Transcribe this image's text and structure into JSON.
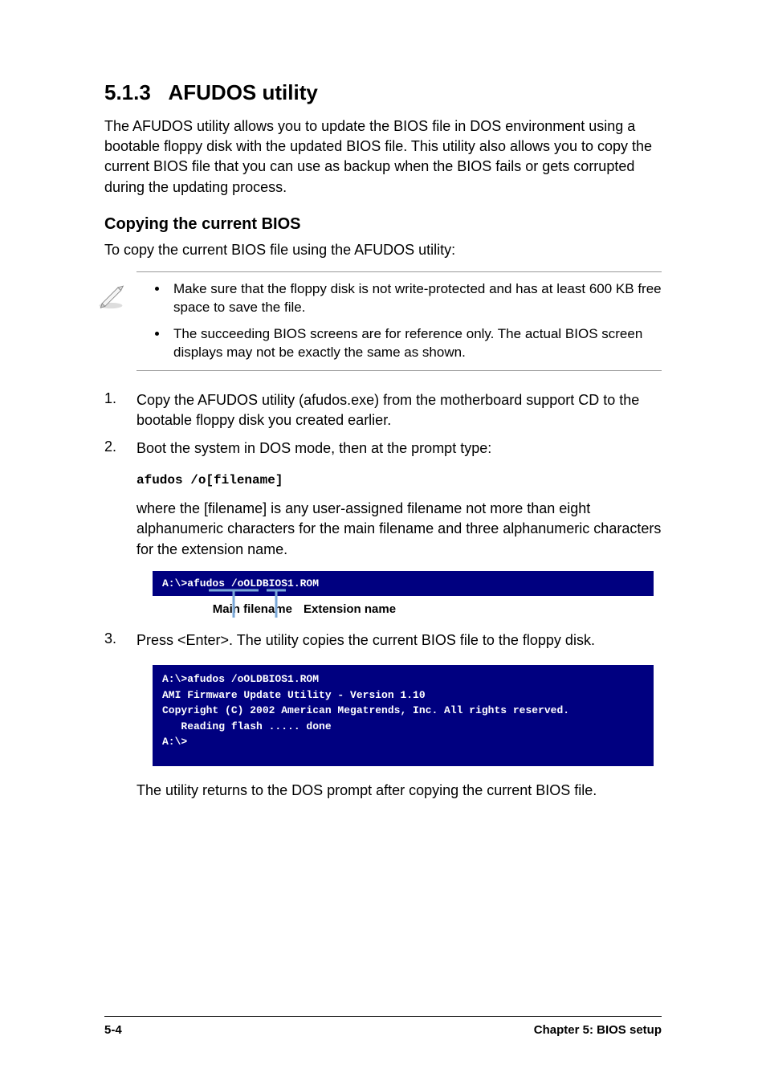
{
  "heading": {
    "number": "5.1.3",
    "title": "AFUDOS utility"
  },
  "intro": "The AFUDOS utility allows you to update the BIOS file in DOS environment using a bootable floppy disk with the updated BIOS file. This utility also allows you to copy the current BIOS file that you can use as backup when the BIOS fails or gets corrupted during the updating process.",
  "subheading": "Copying the current BIOS",
  "subintro": "To copy the current BIOS file using the AFUDOS utility:",
  "notes": [
    "Make sure that the floppy disk is not write-protected and has at least 600 KB free space to save the file.",
    "The succeeding BIOS screens are for reference only. The actual BIOS screen displays may not be exactly the same as shown."
  ],
  "steps": [
    {
      "num": "1.",
      "text": "Copy the AFUDOS utility (afudos.exe) from the motherboard support CD to the bootable floppy disk you created earlier."
    },
    {
      "num": "2.",
      "text": "Boot the system in DOS mode, then at the prompt type:"
    }
  ],
  "code_cmd": "afudos /o[filename]",
  "where_text": "where the [filename] is any user-assigned filename not more than eight alphanumeric characters  for the main filename and three alphanumeric characters for the extension name.",
  "terminal1": "A:\\>afudos /oOLDBIOS1.ROM",
  "annotation": {
    "main": "Main filename",
    "ext": "Extension name"
  },
  "step3": {
    "num": "3.",
    "text": "Press <Enter>. The utility copies the current BIOS file to the floppy disk."
  },
  "terminal2": "A:\\>afudos /oOLDBIOS1.ROM\nAMI Firmware Update Utility - Version 1.10\nCopyright (C) 2002 American Megatrends, Inc. All rights reserved.\n   Reading flash ..... done\nA:\\>",
  "closing": "The utility returns to the DOS prompt after copying the current BIOS file.",
  "footer": {
    "page": "5-4",
    "chapter": "Chapter 5: BIOS setup"
  }
}
